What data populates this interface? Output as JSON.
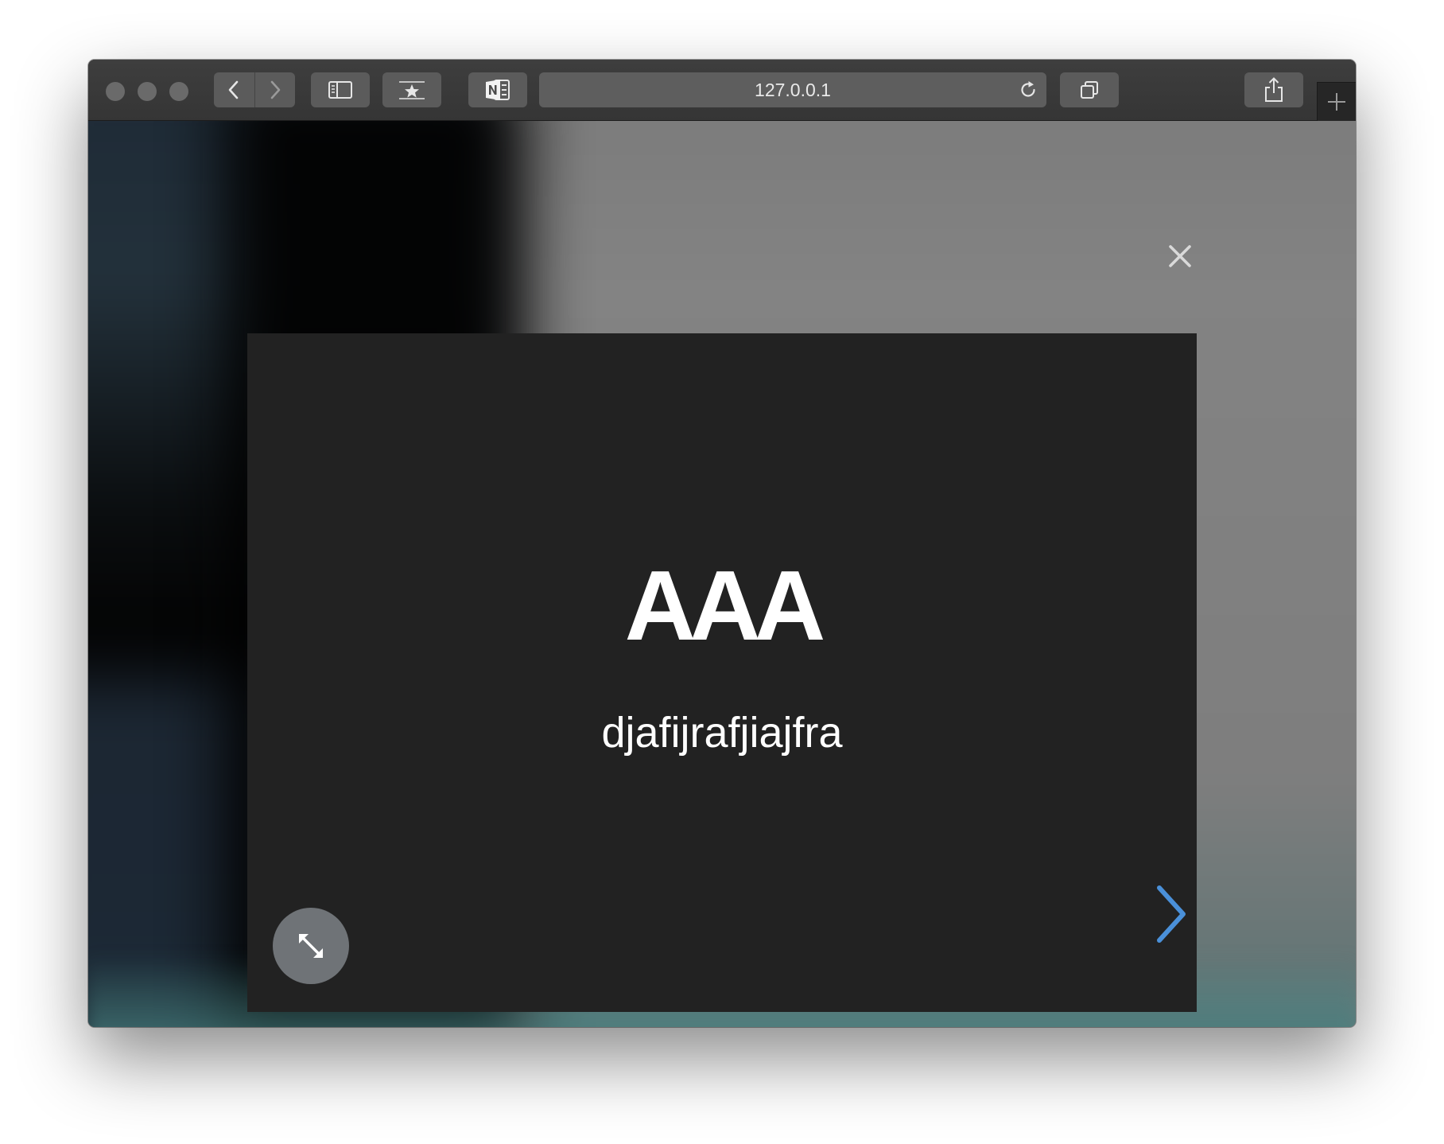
{
  "browser": {
    "url": "127.0.0.1",
    "icons": {
      "window_close": "traffic-light-close",
      "window_minimize": "traffic-light-minimize",
      "window_zoom": "traffic-light-zoom",
      "back": "chevron-left-icon",
      "forward": "chevron-right-icon",
      "sidebar": "sidebar-icon",
      "bookmarks": "star-bookmark-icon",
      "onenote": "onenote-clipper-icon",
      "reload": "reload-icon",
      "tabs": "tab-overview-icon",
      "share": "share-icon",
      "new_tab": "plus-icon"
    }
  },
  "lightbox": {
    "title": "AAA",
    "subtitle": "djafijrafjiajfra",
    "icons": {
      "close": "close-icon",
      "fullscreen": "expand-arrows-icon",
      "next": "chevron-right-icon"
    },
    "colors": {
      "slide_background": "#222222",
      "next_arrow": "#4a90d9",
      "fullscreen_button": "#6f7377"
    }
  }
}
